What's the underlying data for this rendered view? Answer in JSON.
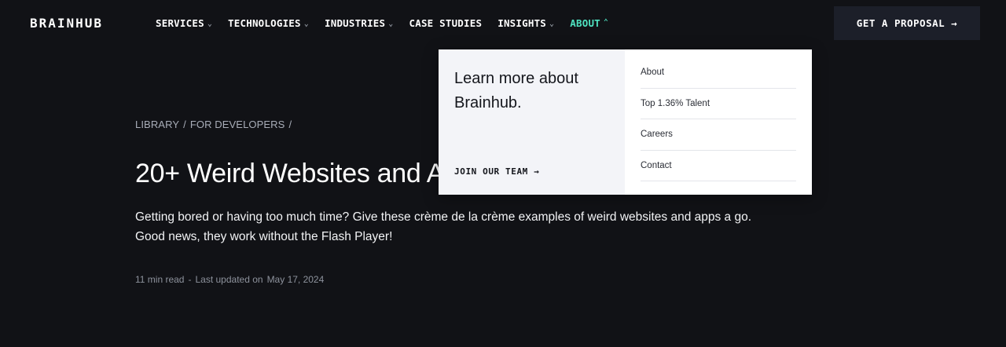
{
  "header": {
    "logo": "BRAINHUB",
    "nav": [
      {
        "label": "SERVICES",
        "has_dropdown": true
      },
      {
        "label": "TECHNOLOGIES",
        "has_dropdown": true
      },
      {
        "label": "INDUSTRIES",
        "has_dropdown": true
      },
      {
        "label": "CASE STUDIES",
        "has_dropdown": false
      },
      {
        "label": "INSIGHTS",
        "has_dropdown": true
      },
      {
        "label": "ABOUT",
        "has_dropdown": true,
        "active": true
      }
    ],
    "cta_label": "GET A PROPOSAL",
    "cta_arrow": "→",
    "accent_color": "#4fe3c1"
  },
  "article": {
    "breadcrumb": [
      "LIBRARY",
      "FOR DEVELOPERS"
    ],
    "breadcrumb_sep": "/",
    "title": "20+ Weird Websites and Apps",
    "intro": "Getting bored or having too much time? Give these crème de la crème examples of weird websites and apps a go. Good news, they work without the Flash Player!",
    "read_time": "11 min read",
    "meta_sep": "-",
    "updated_label": "Last updated on",
    "updated_date": "May 17, 2024"
  },
  "dropdown": {
    "heading": "Learn more about Brainhub.",
    "join_label": "JOIN OUR TEAM",
    "join_arrow": "→",
    "links": [
      "About",
      "Top 1.36% Talent",
      "Careers",
      "Contact"
    ]
  }
}
